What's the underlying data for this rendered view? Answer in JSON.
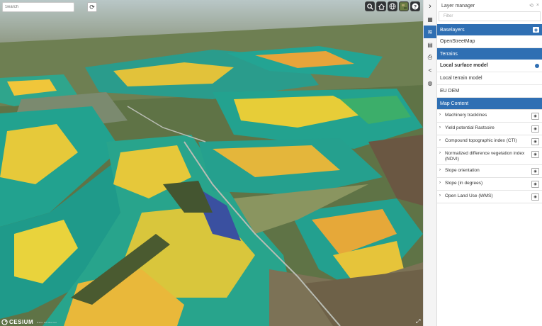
{
  "map": {
    "search_placeholder": "Search",
    "refresh_icon": "refresh-icon",
    "toolbar": [
      {
        "name": "magnifier-icon"
      },
      {
        "name": "home-icon"
      },
      {
        "name": "globe-icon"
      },
      {
        "name": "basemap-picker-icon"
      },
      {
        "name": "help-icon"
      }
    ],
    "logo_text": "CESIUM",
    "credit_text": "Data attribution"
  },
  "rail": {
    "items": [
      {
        "name": "collapse-chevron-icon",
        "glyph": "›"
      },
      {
        "name": "map-icon",
        "glyph": "▦"
      },
      {
        "name": "layers-icon",
        "glyph": "≋",
        "active": true
      },
      {
        "name": "database-icon",
        "glyph": "▤"
      },
      {
        "name": "print-icon",
        "glyph": "⎙"
      },
      {
        "name": "share-icon",
        "glyph": "<"
      },
      {
        "name": "settings-globe-icon",
        "glyph": "◍"
      }
    ]
  },
  "panel": {
    "title": "Layer manager",
    "filter_placeholder": "Filter",
    "baselayers_header": "Baselayers",
    "baselayers": [
      "OpenStreetMap"
    ],
    "terrains_header": "Terrains",
    "terrains": [
      "Local surface model",
      "Local terrain model",
      "EU DEM"
    ],
    "map_content_header": "Map Content",
    "map_content": [
      "Machinery tracklines",
      "Yield potential Rastsoire",
      "Compound topographic index (CTI)",
      "Normalized difference vegetation index (NDVI)",
      "Slope orientation",
      "Slope (in degrees)",
      "Open Land Use (WMS)"
    ]
  },
  "colors": {
    "accent": "#2f6fb3",
    "toolbar": "#303336"
  }
}
